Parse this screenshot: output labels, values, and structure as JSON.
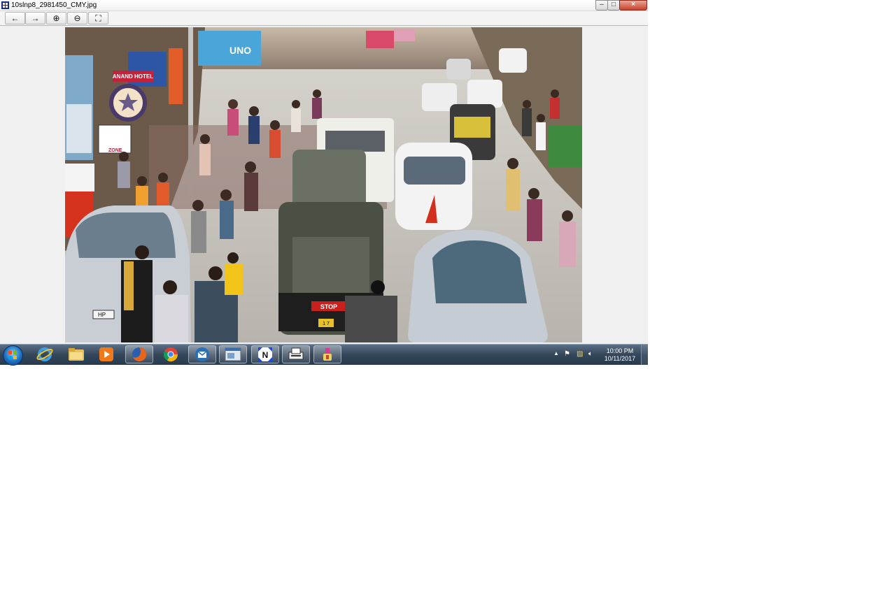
{
  "window": {
    "title": "10slnp8_2981450_CMY.jpg",
    "min_glyph": "–",
    "max_glyph": "□",
    "close_glyph": "×"
  },
  "toolbar": {
    "buttons": [
      {
        "icon": "back-arrow-icon",
        "glyph": "←"
      },
      {
        "icon": "forward-arrow-icon",
        "glyph": "→"
      },
      {
        "icon": "zoom-in-icon",
        "glyph": "⊕"
      },
      {
        "icon": "zoom-out-icon",
        "glyph": "⊖"
      },
      {
        "icon": "fit-window-icon",
        "glyph": "⛶"
      }
    ]
  },
  "photo": {
    "signs": {
      "hotel": "ANAND HOTEL",
      "zone": "ZONE",
      "shop": "UNO",
      "rickshaw_stop": "STOP",
      "plate_left": "HP",
      "plate_rickshaw": "1 7"
    }
  },
  "taskbar": {
    "apps": [
      {
        "name": "internet-explorer",
        "icon": "ie-icon"
      },
      {
        "name": "file-explorer",
        "icon": "folder-icon"
      },
      {
        "name": "media-player",
        "icon": "media-player-icon"
      },
      {
        "name": "firefox",
        "icon": "firefox-icon"
      },
      {
        "name": "chrome",
        "icon": "chrome-icon"
      },
      {
        "name": "mail-app",
        "icon": "mail-icon"
      },
      {
        "name": "window-app",
        "icon": "window-app-icon"
      },
      {
        "name": "image-viewer",
        "icon": "image-viewer-icon"
      },
      {
        "name": "scanner-app",
        "icon": "scanner-icon"
      },
      {
        "name": "paint-app",
        "icon": "paint-icon"
      }
    ],
    "clock": {
      "time": "10:00 PM",
      "date": "10/11/2017"
    }
  },
  "colors": {
    "taskbar": "#34465a",
    "window_bg": "#f0f0f0",
    "close_button": "#c7412b"
  }
}
